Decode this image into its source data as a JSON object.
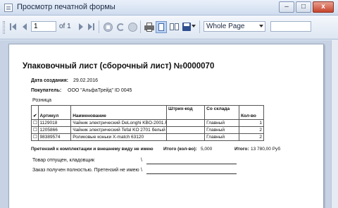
{
  "window": {
    "title": "Просмотр печатной формы",
    "minimize": "–",
    "maximize": "□",
    "close": "x"
  },
  "toolbar": {
    "page_value": "1",
    "of_label": "of 1",
    "zoom_value": "Whole Page"
  },
  "document": {
    "title": "Упаковочный лист (сборочный лист) №0000070",
    "created_label": "Дата создания:",
    "created_value": "29.02.2016",
    "buyer_label": "Покупатель:",
    "buyer_value": "ООО \"АльфаТрейд\" ID 0045",
    "section": "Розница",
    "columns": [
      "✔",
      "Артикул",
      "Наименование",
      "Штрих-код",
      "Со склада",
      "Кол-во"
    ],
    "rows": [
      {
        "check": "☐",
        "article": "1129018",
        "name": "Чайник электрический DeLonghi KBO-2001.R",
        "barcode": "",
        "warehouse": "Главный",
        "qty": "1"
      },
      {
        "check": "☐",
        "article": "1205866",
        "name": "Чайник электрический Tefal KO 2701 белый",
        "barcode": "",
        "warehouse": "Главный",
        "qty": "2"
      },
      {
        "check": "☐",
        "article": "98389574",
        "name": "Роликовые коньки X-match 63120",
        "barcode": "",
        "warehouse": "Главный",
        "qty": "2"
      }
    ],
    "claims_text": "Претензий к комплектации и внешнему виду не имею",
    "total_qty_label": "Итого (кол-во):",
    "total_qty_value": "5,000",
    "total_label": "Итого:",
    "total_value": "13 780,00 Руб",
    "released_label": "Товар отпущен, кладовщик",
    "received_label": "Заказ получен полностью. Претензий не имею",
    "slash": "\\"
  }
}
